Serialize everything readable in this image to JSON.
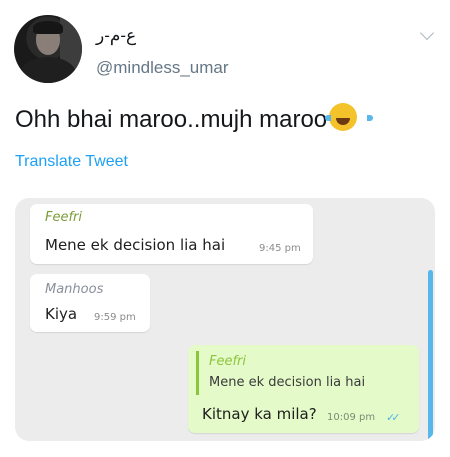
{
  "tweet": {
    "display_name": "ع-م-ر",
    "handle": "@mindless_umar",
    "text": "Ohh bhai maroo..mujh maroo",
    "emoji": "face-with-tears-of-joy",
    "translate_label": "Translate Tweet"
  },
  "chat": {
    "messages": [
      {
        "sender": "Feefri",
        "text": "Mene ek decision lia hai",
        "time": "9:45 pm"
      },
      {
        "sender": "Manhoos",
        "text": "Kiya",
        "time": "9:59 pm"
      },
      {
        "quoted_sender": "Feefri",
        "quoted_text": "Mene ek decision lia hai",
        "text": "Kitnay ka mila?",
        "time": "10:09 pm",
        "status": "✓✓"
      }
    ]
  },
  "colors": {
    "link": "#1da1f2",
    "handle": "#657786",
    "outgoing_bubble": "#e4fbc9",
    "read_ticks": "#4fb4e8"
  }
}
